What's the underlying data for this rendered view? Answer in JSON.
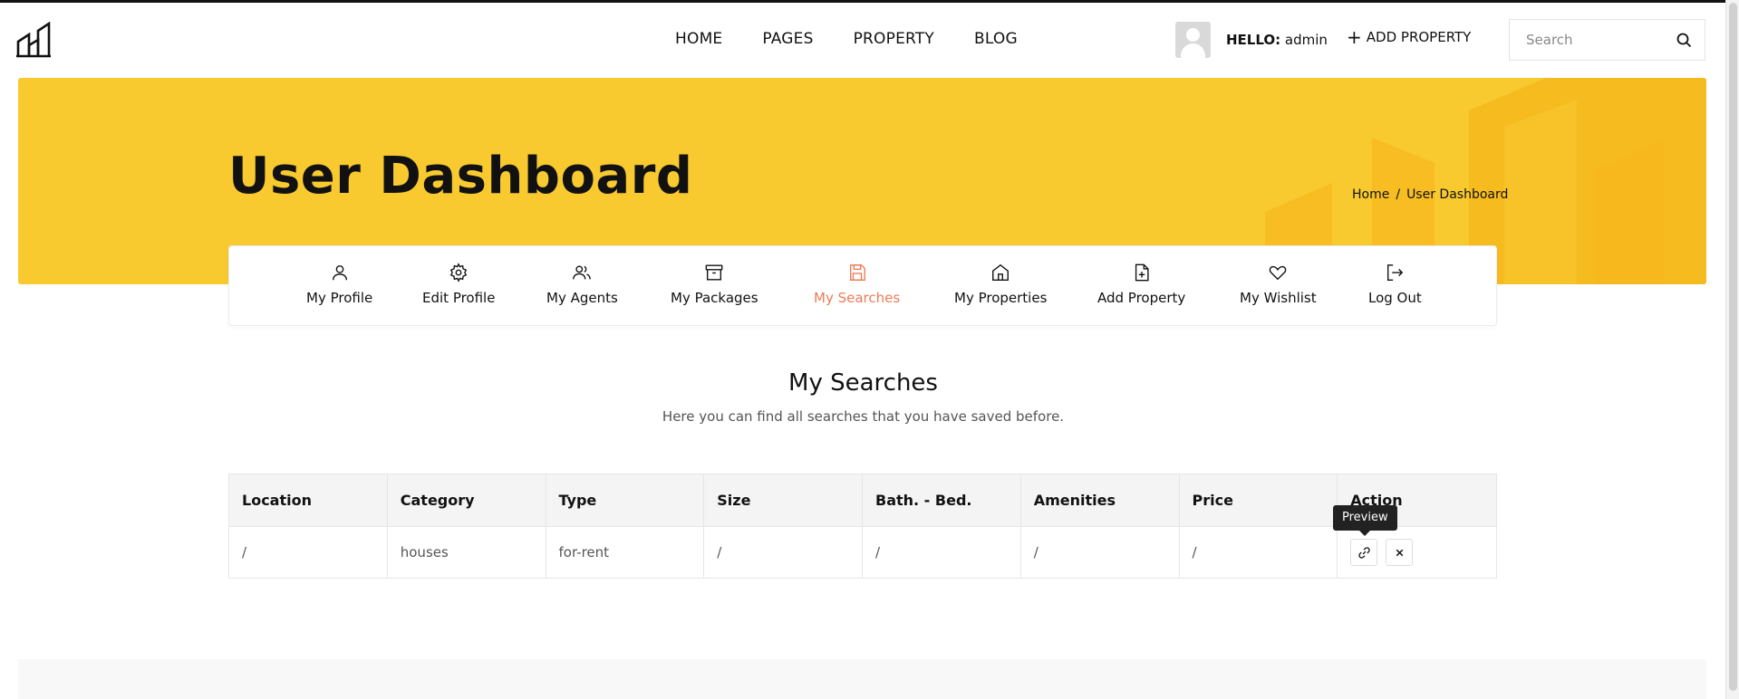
{
  "nav": {
    "items": [
      "HOME",
      "PAGES",
      "PROPERTY",
      "BLOG"
    ]
  },
  "user": {
    "hello_prefix": "HELLO:",
    "name": "admin",
    "add_property": "ADD PROPERTY"
  },
  "search": {
    "placeholder": "Search"
  },
  "banner": {
    "title": "User Dashboard",
    "breadcrumb": {
      "home": "Home",
      "separator": "/",
      "current": "User Dashboard"
    }
  },
  "tabs": [
    {
      "label": "My Profile",
      "icon": "user-icon"
    },
    {
      "label": "Edit Profile",
      "icon": "gear-icon"
    },
    {
      "label": "My Agents",
      "icon": "users-icon"
    },
    {
      "label": "My Packages",
      "icon": "archive-icon"
    },
    {
      "label": "My Searches",
      "icon": "save-icon",
      "active": true
    },
    {
      "label": "My Properties",
      "icon": "home-icon"
    },
    {
      "label": "Add Property",
      "icon": "file-plus-icon"
    },
    {
      "label": "My Wishlist",
      "icon": "heart-icon"
    },
    {
      "label": "Log Out",
      "icon": "logout-icon"
    }
  ],
  "section": {
    "title": "My Searches",
    "subtitle": "Here you can find all searches that you have saved before."
  },
  "table": {
    "headers": [
      "Location",
      "Category",
      "Type",
      "Size",
      "Bath. - Bed.",
      "Amenities",
      "Price",
      "Action"
    ],
    "rows": [
      {
        "cells": [
          "/",
          "houses",
          "for-rent",
          "/",
          "/",
          "/",
          "/"
        ]
      }
    ],
    "tooltip": "Preview"
  },
  "colors": {
    "accent": "#ee7b55",
    "banner": "#f8ca30",
    "banner_shape": "#f6b81c"
  }
}
